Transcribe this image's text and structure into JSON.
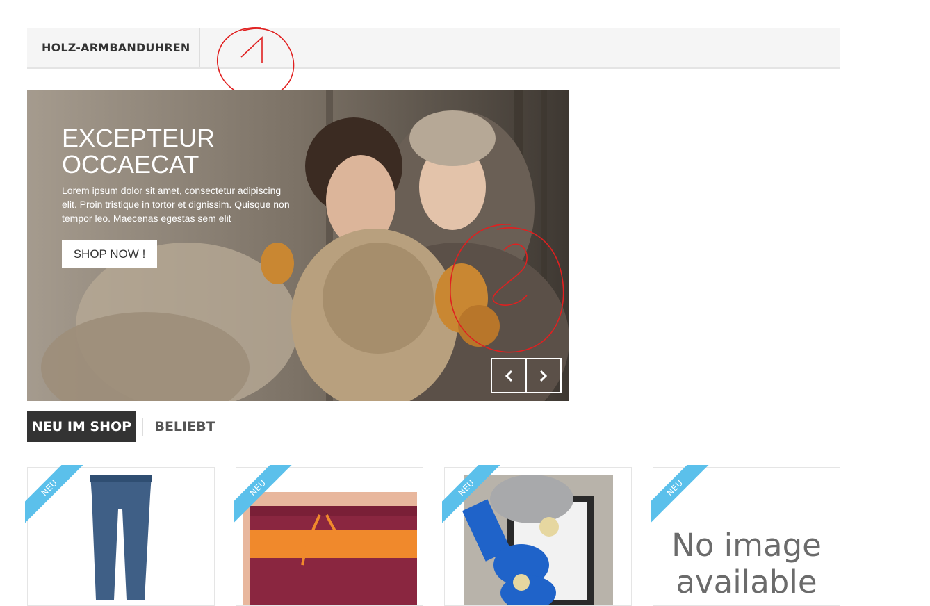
{
  "menu": {
    "items": [
      {
        "label": "HOLZ-ARMBANDUHREN"
      }
    ]
  },
  "slider": {
    "title": "EXCEPTEUR OCCAECAT",
    "text": "Lorem ipsum dolor sit amet, consectetur adipiscing elit. Proin tristique in tortor et dignissim. Quisque non tempor leo. Maecenas egestas sem elit",
    "button_label": "SHOP NOW !",
    "prev_icon": "chevron-left-icon",
    "next_icon": "chevron-right-icon"
  },
  "annotations": {
    "one": "1",
    "two": "2",
    "color": "#e02020"
  },
  "tabs": [
    {
      "label": "NEU IM SHOP",
      "active": true
    },
    {
      "label": "BELIEBT",
      "active": false
    }
  ],
  "products": [
    {
      "badge": "NEU",
      "image": "jeans"
    },
    {
      "badge": "NEU",
      "image": "shorts"
    },
    {
      "badge": "NEU",
      "image": "real-madrid-baby-set"
    },
    {
      "badge": "NEU",
      "image": "no-image",
      "no_image_text": "No image available"
    }
  ],
  "colors": {
    "accent": "#5bc0eb",
    "tab_active_bg": "#333333",
    "menu_bg": "#f5f5f5"
  }
}
